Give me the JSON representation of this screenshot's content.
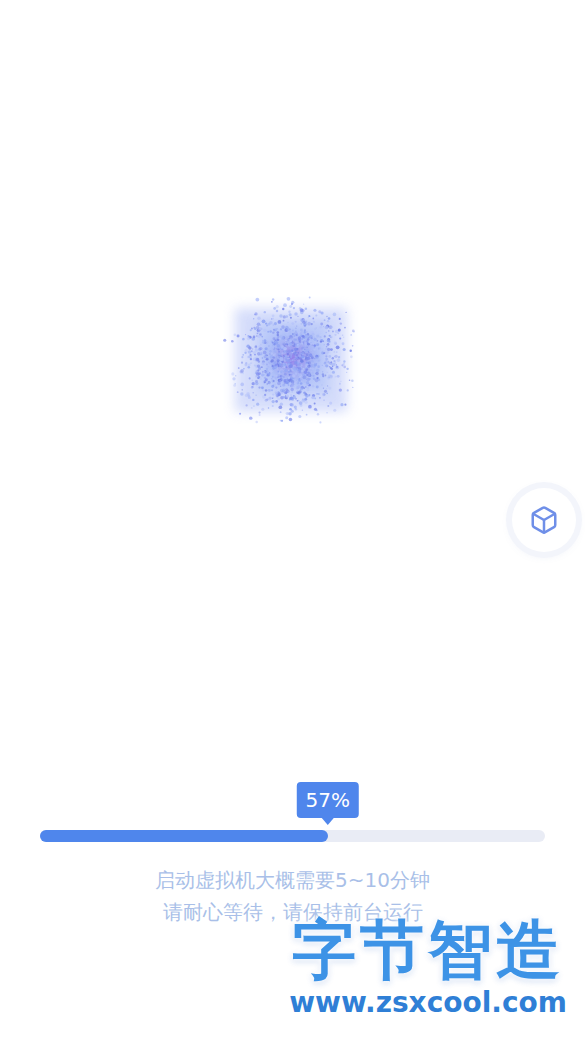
{
  "progress": {
    "level": 0.57,
    "reading": "57%"
  },
  "messages": [
    "启动虚拟机大概需要5~10分钟",
    "请耐心等待，请保持前台运行"
  ],
  "watermark": {
    "title": "字节智造",
    "url": "www.zsxcool.com"
  }
}
